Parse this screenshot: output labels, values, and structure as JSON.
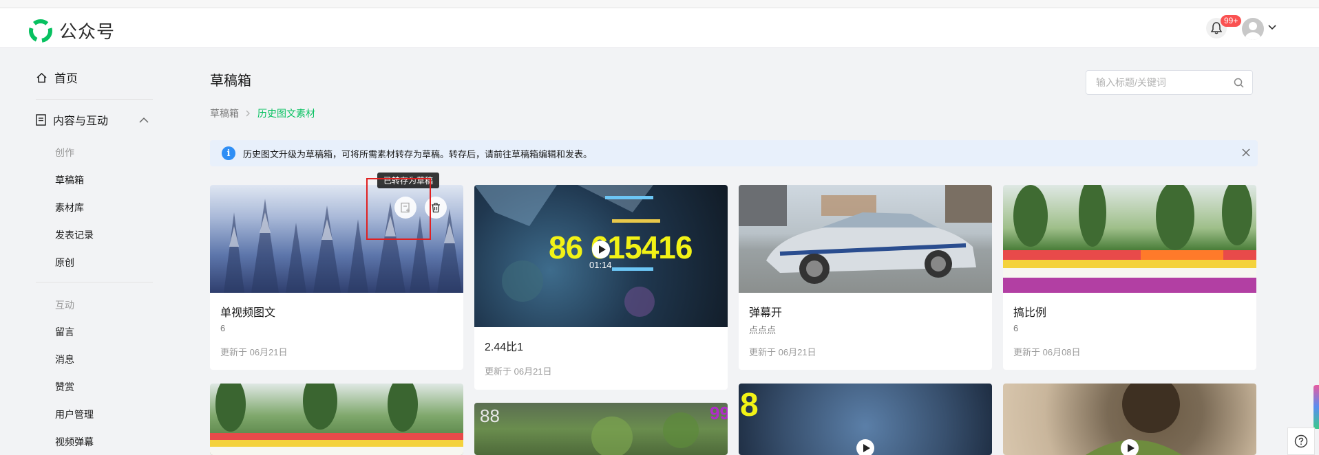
{
  "header": {
    "app_name": "公众号",
    "notification_badge": "99+"
  },
  "sidebar": {
    "home": "首页",
    "content_group": "内容与互动",
    "create_section": "创作",
    "create_items": [
      "草稿箱",
      "素材库",
      "发表记录",
      "原创"
    ],
    "interact_section": "互动",
    "interact_items": [
      "留言",
      "消息",
      "赞赏",
      "用户管理",
      "视频弹幕"
    ]
  },
  "main": {
    "page_title": "草稿箱",
    "search": {
      "placeholder": "输入标题/关键词"
    },
    "breadcrumb": [
      "草稿箱",
      "历史图文素材"
    ],
    "notice": "历史图文升级为草稿箱，可将所需素材转存为草稿。转存后，请前往草稿箱编辑和发表。",
    "tooltip": "已转存为草稿",
    "cards": [
      {
        "title": "单视频图文",
        "subtitle": "6",
        "date": "更新于 06月21日"
      },
      {
        "title": "2.44比1",
        "subtitle": "",
        "date": "更新于 06月21日",
        "overlay_text": "86 615416",
        "duration": "01:14"
      },
      {
        "title": "弹幕开",
        "subtitle": "点点点",
        "date": "更新于 06月21日"
      },
      {
        "title": "搞比例",
        "subtitle": "6",
        "date": "更新于 06月08日"
      }
    ],
    "row2_overlays": [
      "88",
      "99",
      "8"
    ]
  },
  "colors": {
    "brand_green": "#07c160",
    "badge_red": "#fa5151",
    "notice_bg": "#e8f0fb",
    "info_blue": "#2e8ef5",
    "highlight_red": "#e02020"
  }
}
